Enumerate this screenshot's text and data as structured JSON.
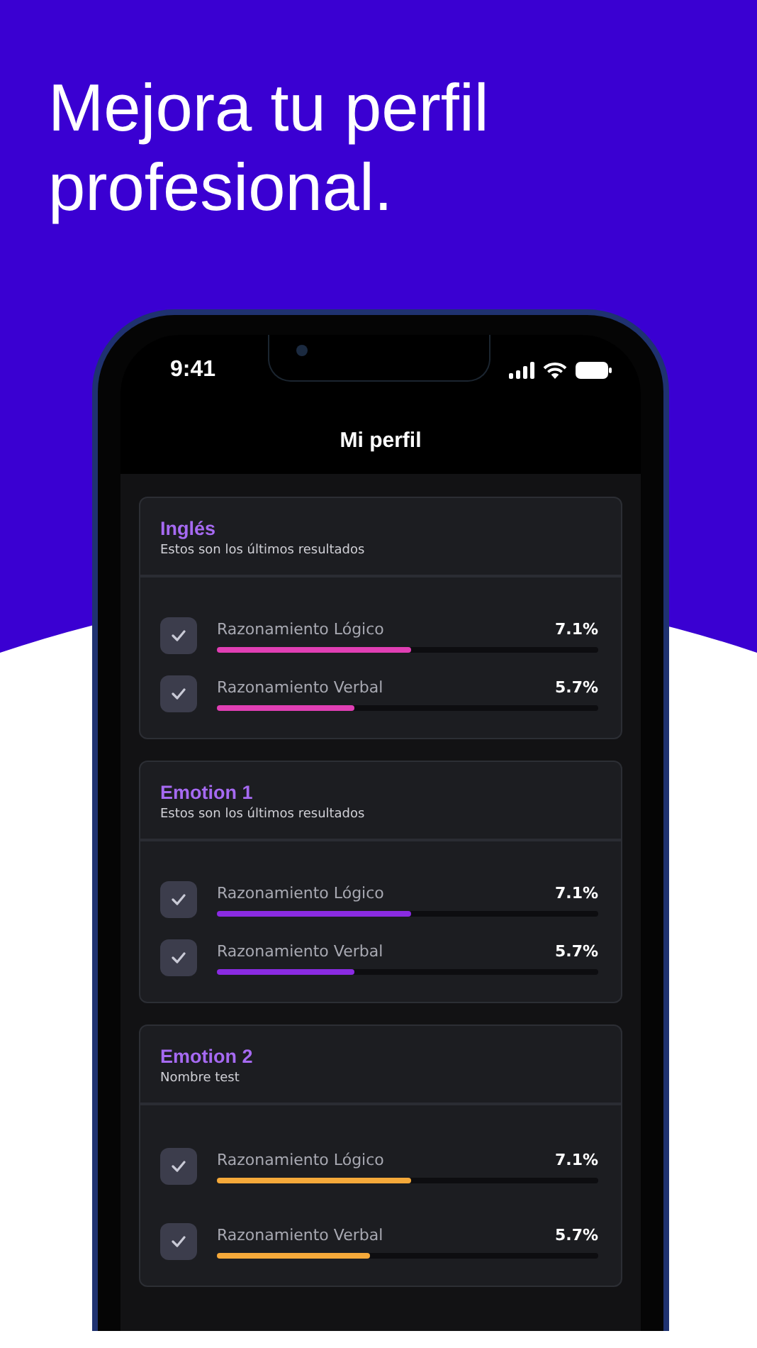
{
  "headline": "Mejora tu perfil profesional.",
  "status_bar": {
    "time": "9:41"
  },
  "screen_title": "Mi perfil",
  "cards": [
    {
      "title": "Inglés",
      "subtitle": "Estos son los últimos resultados",
      "color": "#e03fb4",
      "rows": [
        {
          "label": "Razonamiento Lógico",
          "value": "7.1%",
          "level": 0.51,
          "checked": true
        },
        {
          "label": "Razonamiento Verbal",
          "value": "5.7%",
          "level": 0.36,
          "checked": true
        }
      ]
    },
    {
      "title": "Emotion 1",
      "subtitle": "Estos son los últimos resultados",
      "color": "#8a2be2",
      "rows": [
        {
          "label": "Razonamiento Lógico",
          "value": "7.1%",
          "level": 0.51,
          "checked": true
        },
        {
          "label": "Razonamiento Verbal",
          "value": "5.7%",
          "level": 0.36,
          "checked": true
        }
      ]
    },
    {
      "title": "Emotion 2",
      "subtitle": "Nombre test",
      "color": "#f5a93a",
      "rows": [
        {
          "label": "Razonamiento Lógico",
          "value": "7.1%",
          "level": 0.51,
          "checked": true
        },
        {
          "label": "Razonamiento Verbal",
          "value": "5.7%",
          "level": 0.4,
          "checked": true
        }
      ]
    }
  ]
}
